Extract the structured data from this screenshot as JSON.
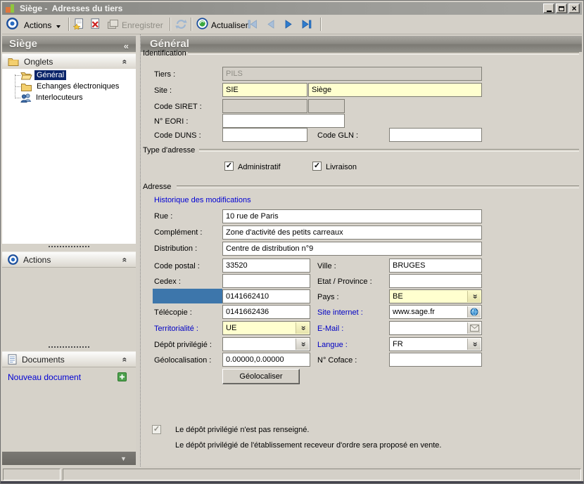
{
  "titlebar": {
    "title": "Siège -  Adresses du tiers"
  },
  "toolbar": {
    "actions": "Actions",
    "enregistrer": "Enregistrer",
    "actualiser": "Actualiser"
  },
  "sidebar": {
    "header": "Siège",
    "onglets": {
      "title": "Onglets",
      "items": [
        {
          "label": "Général"
        },
        {
          "label": "Echanges électroniques"
        },
        {
          "label": "Interlocuteurs"
        }
      ]
    },
    "actions_title": "Actions",
    "documents_title": "Documents",
    "nouveau_document": "Nouveau document"
  },
  "main": {
    "header": "Général",
    "identification": {
      "title": "Identification",
      "tiers_label": "Tiers :",
      "tiers_value": "PILS",
      "site_label": "Site :",
      "site_code": "SIE",
      "site_name": "Siège",
      "siret_label": "Code SIRET :",
      "eori_label": "N° EORI :",
      "duns_label": "Code DUNS :",
      "gln_label": "Code GLN :"
    },
    "type_adresse": {
      "title": "Type d'adresse",
      "administratif": "Administratif",
      "livraison": "Livraison"
    },
    "adresse": {
      "title": "Adresse",
      "historique": "Historique des modifications",
      "rue_label": "Rue :",
      "rue_value": "10 rue de Paris",
      "complement_label": "Complément :",
      "complement_value": "Zone d'activité des petits carreaux",
      "distribution_label": "Distribution :",
      "distribution_value": "Centre de distribution n°9",
      "code_postal_label": "Code postal :",
      "code_postal_value": "33520",
      "ville_label": "Ville :",
      "ville_value": "BRUGES",
      "cedex_label": "Cedex :",
      "cedex_value": "",
      "etat_label": "Etat / Province :",
      "etat_value": "",
      "telephone_value": "0141662410",
      "pays_label": "Pays :",
      "pays_value": "BE",
      "telecopie_label": "Télécopie :",
      "telecopie_value": "0141662436",
      "site_internet_label": "Site internet :",
      "site_internet_value": "www.sage.fr",
      "territorialite_label": "Territorialité :",
      "territorialite_value": "UE",
      "email_label": "E-Mail :",
      "email_value": "",
      "depot_label": "Dépôt privilégié :",
      "depot_value": "",
      "langue_label": "Langue :",
      "langue_value": "FR",
      "geolocalisation_label": "Géolocalisation :",
      "geolocalisation_value": "0.00000,0.00000",
      "coface_label": "N° Coface :",
      "coface_value": "",
      "geolocaliser_button": "Géolocaliser"
    },
    "footer": {
      "checkbox_text": "Le dépôt privilégié n'est pas renseigné.",
      "info_text": "Le dépôt privilégié de l'établissement receveur d'ordre sera proposé en vente."
    }
  },
  "icons": {
    "check": "✓",
    "chevrons": "«",
    "caret_down": "▼"
  },
  "colors": {
    "field_yellow": "#ffffcf",
    "disabled_gray": "#d4d0c8",
    "highlight_blue": "#3d76ab",
    "selection_navy": "#0a246a",
    "link_blue": "#0000c4",
    "header_gray": "#8c8a84"
  }
}
